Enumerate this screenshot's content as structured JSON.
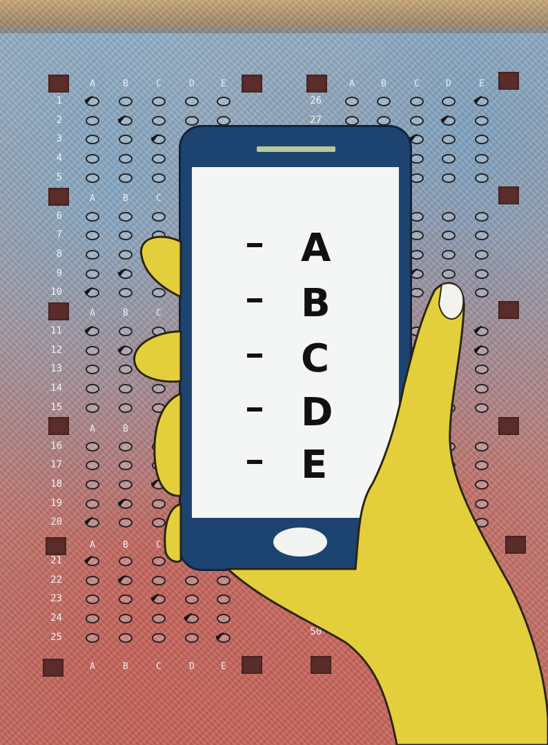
{
  "sheet": {
    "column_headers": [
      "A",
      "B",
      "C",
      "D",
      "E"
    ],
    "left_rows": [
      "1",
      "2",
      "3",
      "4",
      "5",
      "6",
      "7",
      "8",
      "9",
      "10",
      "11",
      "12",
      "13",
      "14",
      "15",
      "16",
      "17",
      "18",
      "19",
      "20",
      "21",
      "22",
      "23",
      "24",
      "25"
    ],
    "right_rows_visible": [
      "26",
      "27"
    ],
    "right_bottom_number": "50"
  },
  "phone": {
    "options": [
      {
        "dash": "-",
        "letter": "A"
      },
      {
        "dash": "-",
        "letter": "B"
      },
      {
        "dash": "-",
        "letter": "C"
      },
      {
        "dash": "-",
        "letter": "D"
      },
      {
        "dash": "-",
        "letter": "E"
      }
    ]
  },
  "colors": {
    "phone_body": "#1d4370",
    "screen": "#f4f5f5",
    "hand": "#e3cf3c",
    "speaker": "#b8c79a"
  }
}
